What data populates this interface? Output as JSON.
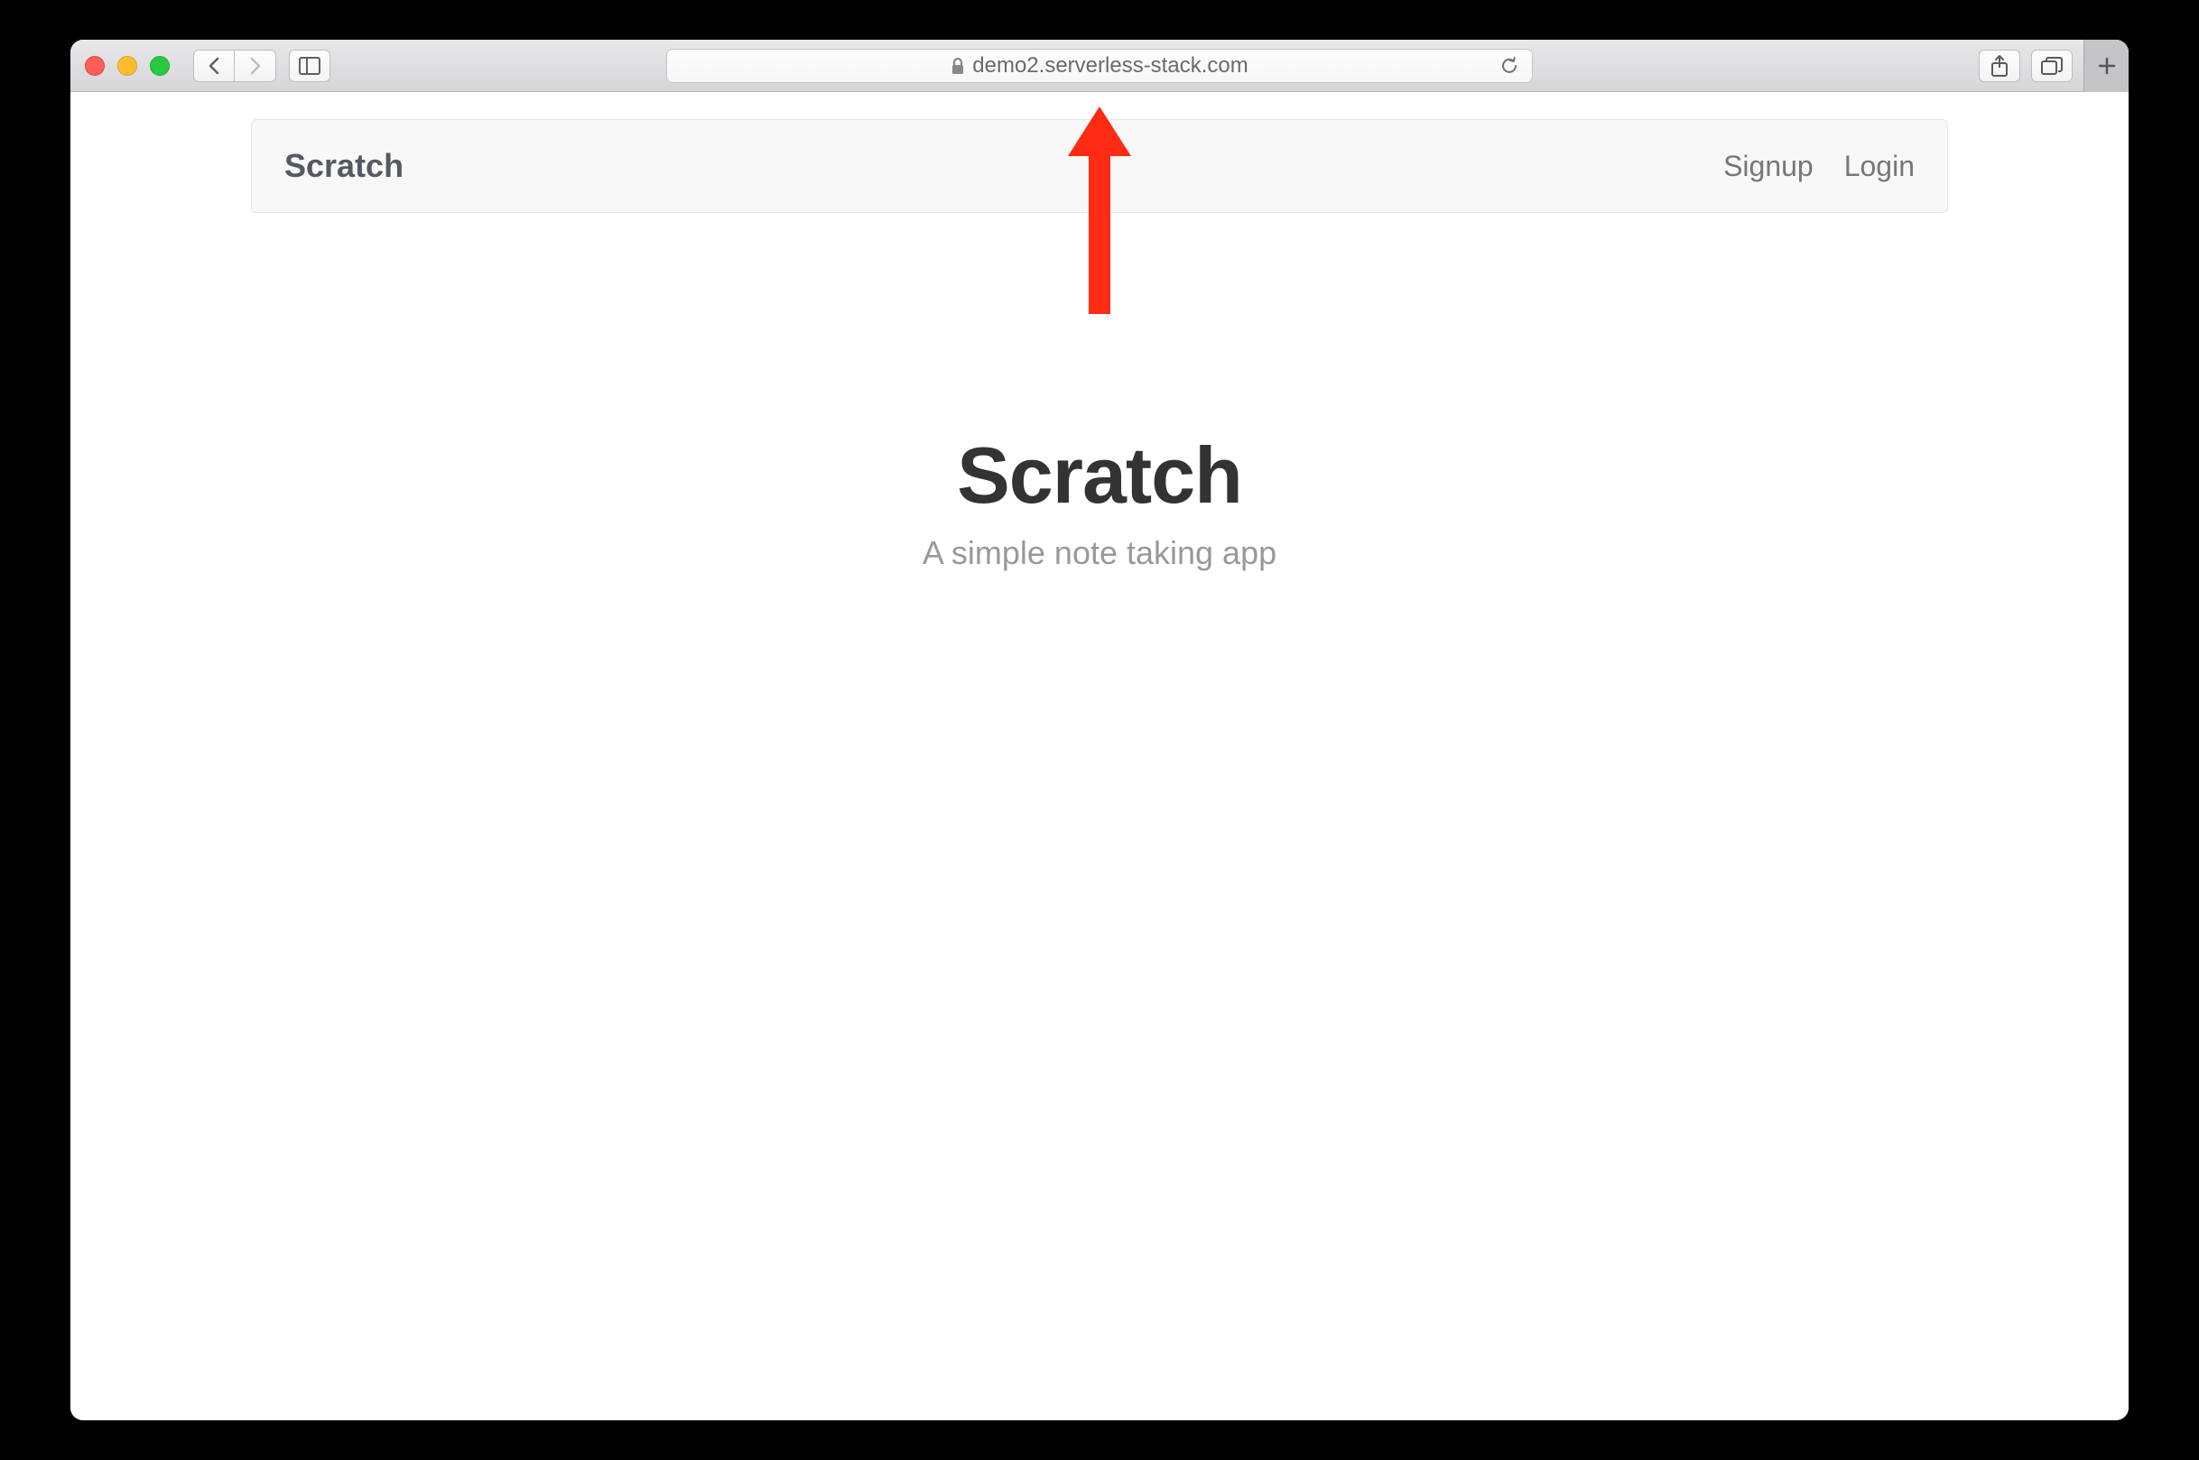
{
  "browser": {
    "url_display": "demo2.serverless-stack.com"
  },
  "navbar": {
    "brand": "Scratch",
    "links": {
      "signup": "Signup",
      "login": "Login"
    }
  },
  "hero": {
    "title": "Scratch",
    "subtitle": "A simple note taking app"
  }
}
